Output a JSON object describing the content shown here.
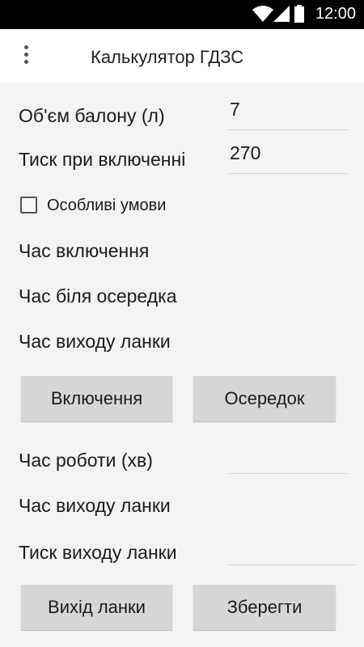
{
  "status_bar": {
    "time": "12:00",
    "icons": [
      "wifi-icon",
      "signal-icon",
      "battery-icon"
    ]
  },
  "app_bar": {
    "title": "Калькулятор ГДЗС",
    "menu_icon": "overflow-menu-icon"
  },
  "form": {
    "volume_label": "Об'єм балону (л)",
    "volume_value": "7",
    "pressure_label": "Тиск при включенні",
    "pressure_value": "270",
    "special_conditions_label": "Особливі умови",
    "special_conditions_checked": false,
    "time_on_label": "Час включення",
    "time_at_source_label": "Час біля осередка",
    "time_exit_label": "Час виходу ланки",
    "btn_on": "Включення",
    "btn_source": "Осередок",
    "work_time_label": "Час роботи (хв)",
    "work_time_value": "",
    "exit_time_label": "Час виходу ланки",
    "exit_pressure_label": "Тиск виходу ланки",
    "exit_pressure_value": "",
    "btn_exit": "Вихід ланки",
    "btn_save": "Зберегти"
  }
}
